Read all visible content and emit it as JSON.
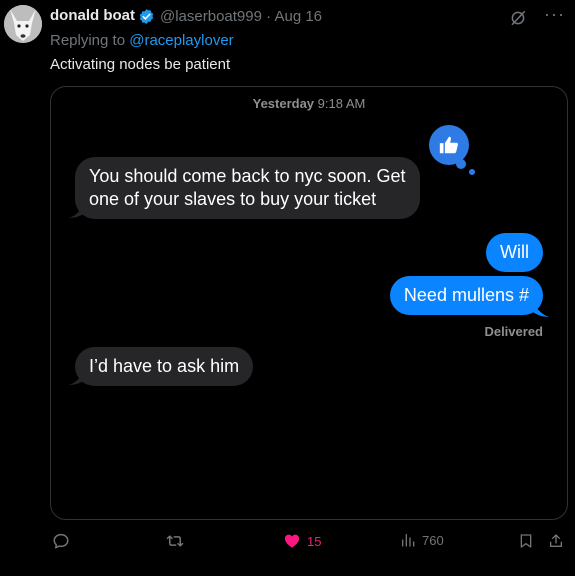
{
  "tweet": {
    "author_name": "donald boat",
    "handle": "@laserboat999",
    "date": "Aug 16",
    "replying_label": "Replying to",
    "replying_to": "@raceplaylover",
    "text": "Activating nodes be patient",
    "more_label": "···"
  },
  "imessage": {
    "day": "Yesterday",
    "time": "9:18 AM",
    "messages": [
      {
        "direction": "in",
        "lines": [
          "You should come back to nyc soon. Get",
          "one of your slaves to buy your ticket"
        ]
      },
      {
        "direction": "out",
        "text": "Will"
      },
      {
        "direction": "out",
        "text": "Need mullens #"
      },
      {
        "direction": "in",
        "text": "I’d have to ask him"
      }
    ],
    "status": "Delivered",
    "tapback_icon": "thumbs-up-icon"
  },
  "actions": {
    "likes": "15",
    "views": "760"
  },
  "colors": {
    "accent": "#1d9bf0",
    "like": "#f91880",
    "bubble_out": "#0a84ff",
    "bubble_in": "#262628"
  }
}
